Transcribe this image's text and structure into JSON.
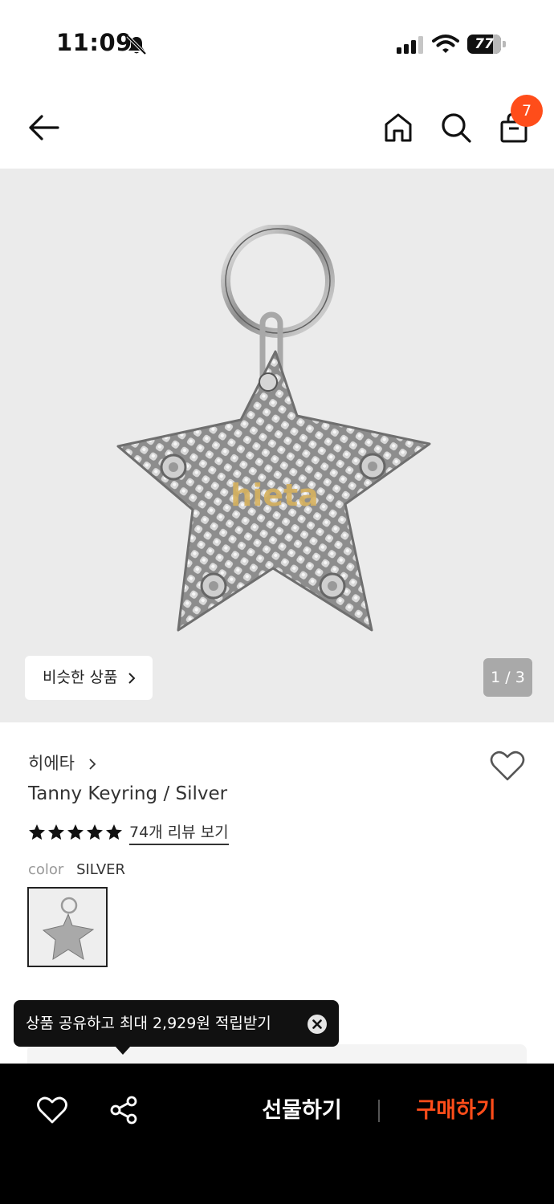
{
  "status_bar": {
    "time": "11:09",
    "battery": "77",
    "battery_level": 0.77
  },
  "header": {
    "cart_count": "7"
  },
  "gallery": {
    "similar_label": "비슷한 상품",
    "page_indicator": "1 / 3",
    "logo_text": "hieta"
  },
  "product": {
    "brand": "히에타",
    "name": "Tanny Keyring / Silver",
    "rating_stars": 5,
    "review_link": "74개 리뷰 보기",
    "color_label": "color",
    "color_value": "SILVER"
  },
  "tooltip": {
    "text": "상품 공유하고 최대 2,929원 적립받기"
  },
  "bottom_bar": {
    "gift_label": "선물하기",
    "buy_label": "구매하기"
  },
  "colors": {
    "accent": "#ff4d1a",
    "bottom_bar": "#000000",
    "gallery_bg": "#ebebeb"
  }
}
